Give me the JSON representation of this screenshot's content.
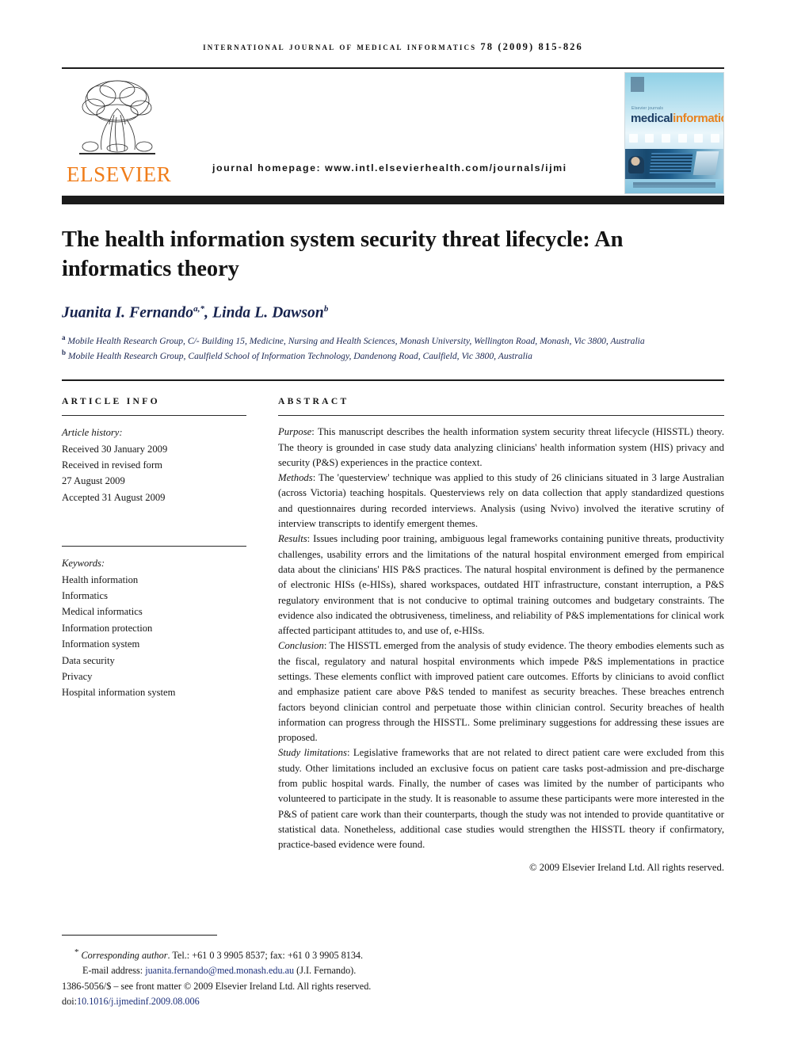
{
  "running_head": "international journal of medical informatics 78 (2009) 815-826",
  "masthead": {
    "publisher_wordmark": "ELSEVIER",
    "publisher_logo_icon": "elsevier-tree-logo",
    "homepage_text": "journal homepage: www.intl.elsevierhealth.com/journals/ijmi",
    "cover": {
      "kicker": "Elsevier journals",
      "title_part1": "medical",
      "title_part2": "informatics",
      "mark_icon": "elsevier-tree-mark-icon",
      "color_title1": "#1d3f66",
      "color_title2": "#e8821e"
    }
  },
  "title": "The health information system security threat lifecycle: An informatics theory",
  "authors": {
    "author1_name": "Juanita I. Fernando",
    "author1_sup": "a,*",
    "separator": ", ",
    "author2_name": "Linda L. Dawson",
    "author2_sup": "b"
  },
  "affiliations": [
    {
      "marker": "a",
      "text": "Mobile Health Research Group, C/- Building 15, Medicine, Nursing and Health Sciences, Monash University, Wellington Road, Monash, Vic 3800, Australia"
    },
    {
      "marker": "b",
      "text": "Mobile Health Research Group, Caulfield School of Information Technology, Dandenong Road, Caulfield, Vic 3800, Australia"
    }
  ],
  "article_info": {
    "heading": "ARTICLE INFO",
    "history_label": "Article history:",
    "history": [
      "Received 30 January 2009",
      "Received in revised form",
      "27 August 2009",
      "Accepted 31 August 2009"
    ],
    "keywords_label": "Keywords:",
    "keywords": [
      "Health information",
      "Informatics",
      "Medical informatics",
      "Information protection",
      "Information system",
      "Data security",
      "Privacy",
      "Hospital information system"
    ]
  },
  "abstract": {
    "heading": "ABSTRACT",
    "sections": [
      {
        "label": "Purpose",
        "text": ": This manuscript describes the health information system security threat lifecycle (HISSTL) theory. The theory is grounded in case study data analyzing clinicians' health information system (HIS) privacy and security (P&S) experiences in the practice context."
      },
      {
        "label": "Methods",
        "text": ": The 'questerview' technique was applied to this study of 26 clinicians situated in 3 large Australian (across Victoria) teaching hospitals. Questerviews rely on data collection that apply standardized questions and questionnaires during recorded interviews. Analysis (using Nvivo) involved the iterative scrutiny of interview transcripts to identify emergent themes."
      },
      {
        "label": "Results",
        "text": ": Issues including poor training, ambiguous legal frameworks containing punitive threats, productivity challenges, usability errors and the limitations of the natural hospital environment emerged from empirical data about the clinicians' HIS P&S practices. The natural hospital environment is defined by the permanence of electronic HISs (e-HISs), shared workspaces, outdated HIT infrastructure, constant interruption, a P&S regulatory environment that is not conducive to optimal training outcomes and budgetary constraints. The evidence also indicated the obtrusiveness, timeliness, and reliability of P&S implementations for clinical work affected participant attitudes to, and use of, e-HISs."
      },
      {
        "label": "Conclusion",
        "text": ": The HISSTL emerged from the analysis of study evidence. The theory embodies elements such as the fiscal, regulatory and natural hospital environments which impede P&S implementations in practice settings. These elements conflict with improved patient care outcomes. Efforts by clinicians to avoid conflict and emphasize patient care above P&S tended to manifest as security breaches. These breaches entrench factors beyond clinician control and perpetuate those within clinician control. Security breaches of health information can progress through the HISSTL. Some preliminary suggestions for addressing these issues are proposed."
      },
      {
        "label": "Study limitations",
        "text": ": Legislative frameworks that are not related to direct patient care were excluded from this study. Other limitations included an exclusive focus on patient care tasks post-admission and pre-discharge from public hospital wards. Finally, the number of cases was limited by the number of participants who volunteered to participate in the study. It is reasonable to assume these participants were more interested in the P&S of patient care work than their counterparts, though the study was not intended to provide quantitative or statistical data. Nonetheless, additional case studies would strengthen the HISSTL theory if confirmatory, practice-based evidence were found."
      }
    ],
    "copyright": "© 2009 Elsevier Ireland Ltd. All rights reserved."
  },
  "footer": {
    "corresponding_marker": "*",
    "corresponding_label": "Corresponding author",
    "corresponding_contact": ". Tel.: +61 0 3 9905 8537; fax: +61 0 3 9905 8134.",
    "email_label": "E-mail address:",
    "email": "juanita.fernando@med.monash.edu.au",
    "email_suffix": "(J.I. Fernando).",
    "front_matter": "1386-5056/$ – see front matter © 2009 Elsevier Ireland Ltd. All rights reserved.",
    "doi_label": "doi:",
    "doi": "10.1016/j.ijmedinf.2009.08.006",
    "link_color": "#1c2f7a"
  }
}
